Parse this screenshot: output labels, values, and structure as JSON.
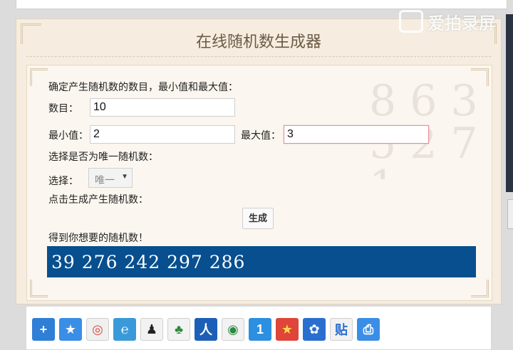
{
  "watermark": {
    "text": "爱拍录屏"
  },
  "page": {
    "title": "在线随机数生成器"
  },
  "form": {
    "intro": "确定产生随机数的数目，最小值和最大值：",
    "count_label": "数目：",
    "count_value": "10",
    "min_label": "最小值：",
    "min_value": "2",
    "max_label": "最大值：",
    "max_value": "3",
    "unique_prompt": "选择是否为唯一随机数：",
    "select_label": "选择：",
    "select_value": "唯一",
    "generate_prompt": "点击生成产生随机数：",
    "generate_button": "生成",
    "result_label": "得到你想要的随机数！",
    "result_value": "39  276  242  297  286"
  },
  "decoration": {
    "digits": "8 6 3 5 2 7 1"
  },
  "share_icons": [
    {
      "name": "plus-icon",
      "glyph": "+",
      "color": "#2f7fd6"
    },
    {
      "name": "star-icon",
      "glyph": "★",
      "color": "#3a8ee6"
    },
    {
      "name": "weibo-icon",
      "glyph": "◎",
      "color": "#f0f0f0"
    },
    {
      "name": "qzone-icon",
      "glyph": "℮",
      "color": "#3a9ad9"
    },
    {
      "name": "qq-icon",
      "glyph": "♟",
      "color": "#f2f2f2"
    },
    {
      "name": "clover-icon",
      "glyph": "♣",
      "color": "#f2f2f2"
    },
    {
      "name": "renren-icon",
      "glyph": "人",
      "color": "#1d5fb8"
    },
    {
      "name": "wechat-icon",
      "glyph": "◉",
      "color": "#f2f2f2"
    },
    {
      "name": "one-icon",
      "glyph": "1",
      "color": "#2d8fe0"
    },
    {
      "name": "favorite-star-icon",
      "glyph": "★",
      "color": "#e0453a"
    },
    {
      "name": "baidu-icon",
      "glyph": "✿",
      "color": "#2a6fcf"
    },
    {
      "name": "tieba-icon",
      "glyph": "贴",
      "color": "#f2f2f2"
    },
    {
      "name": "print-icon",
      "glyph": "⎙",
      "color": "#3a8ee6"
    }
  ]
}
